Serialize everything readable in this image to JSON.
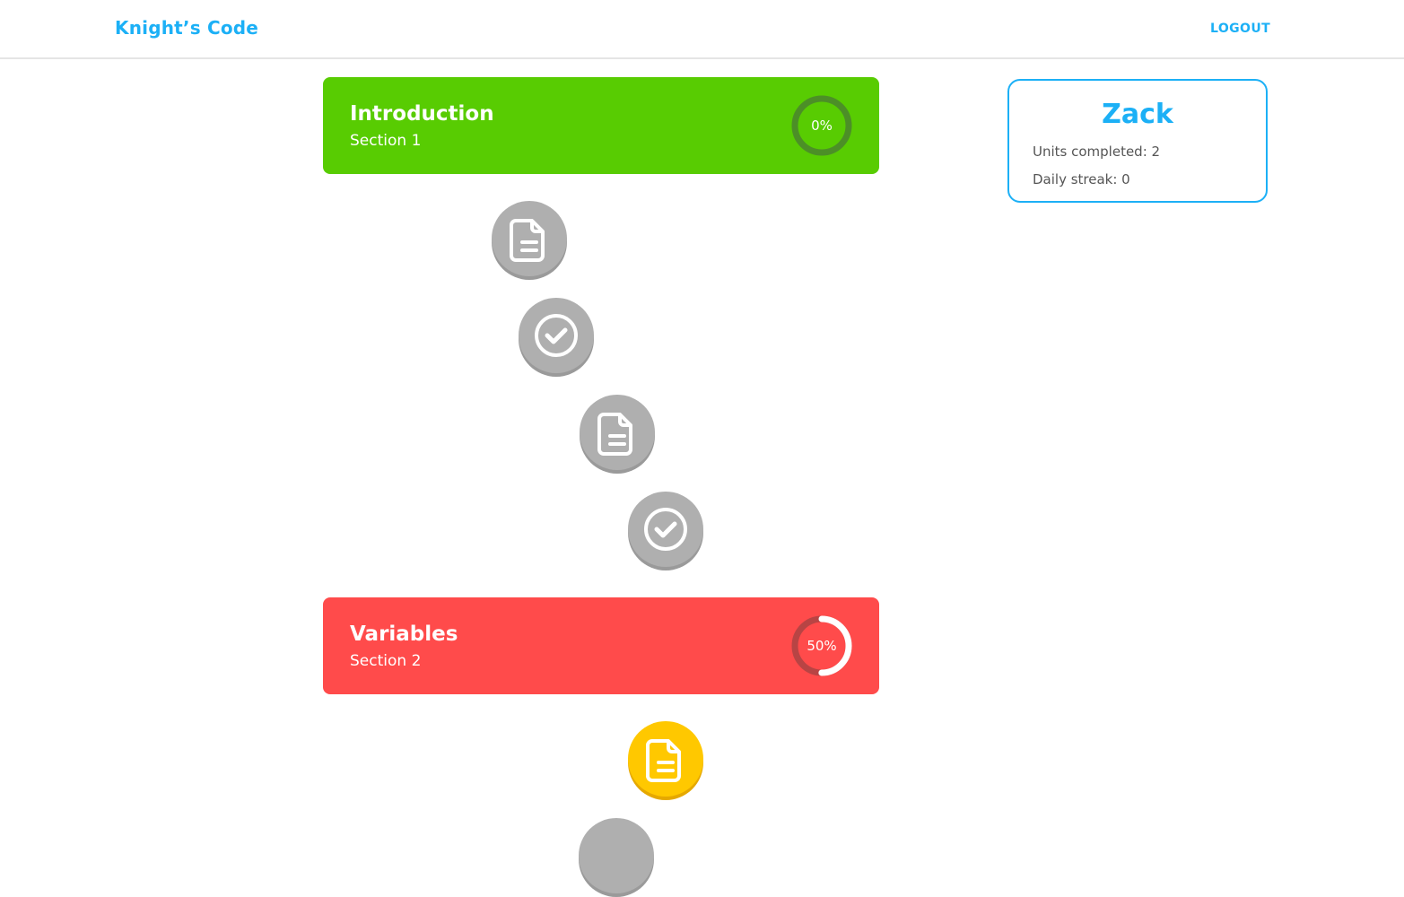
{
  "header": {
    "brand": "Knight’s Code",
    "logout_label": "LOGOUT"
  },
  "sections": [
    {
      "title": "Introduction",
      "subtitle": "Section 1",
      "progress_label": "0%",
      "progress": 0,
      "color": "#58cc02",
      "ring_track_color": "#4c8f27",
      "units": [
        {
          "icon": "document-icon",
          "state": "locked"
        },
        {
          "icon": "check-circle-icon",
          "state": "locked"
        },
        {
          "icon": "document-icon",
          "state": "locked"
        },
        {
          "icon": "check-circle-icon",
          "state": "locked"
        }
      ]
    },
    {
      "title": "Variables",
      "subtitle": "Section 2",
      "progress_label": "50%",
      "progress": 0.5,
      "color": "#ff4b4b",
      "ring_track_color": "#b84444",
      "units": [
        {
          "icon": "document-icon",
          "state": "active"
        },
        {
          "icon": "unit-icon",
          "state": "locked"
        }
      ]
    }
  ],
  "profile": {
    "name": "Zack",
    "units_completed": "Units completed: 2",
    "daily_streak": "Daily streak: 0"
  },
  "colors": {
    "accent": "#1cb0f6",
    "locked": "#afafaf",
    "active": "#ffc800"
  }
}
